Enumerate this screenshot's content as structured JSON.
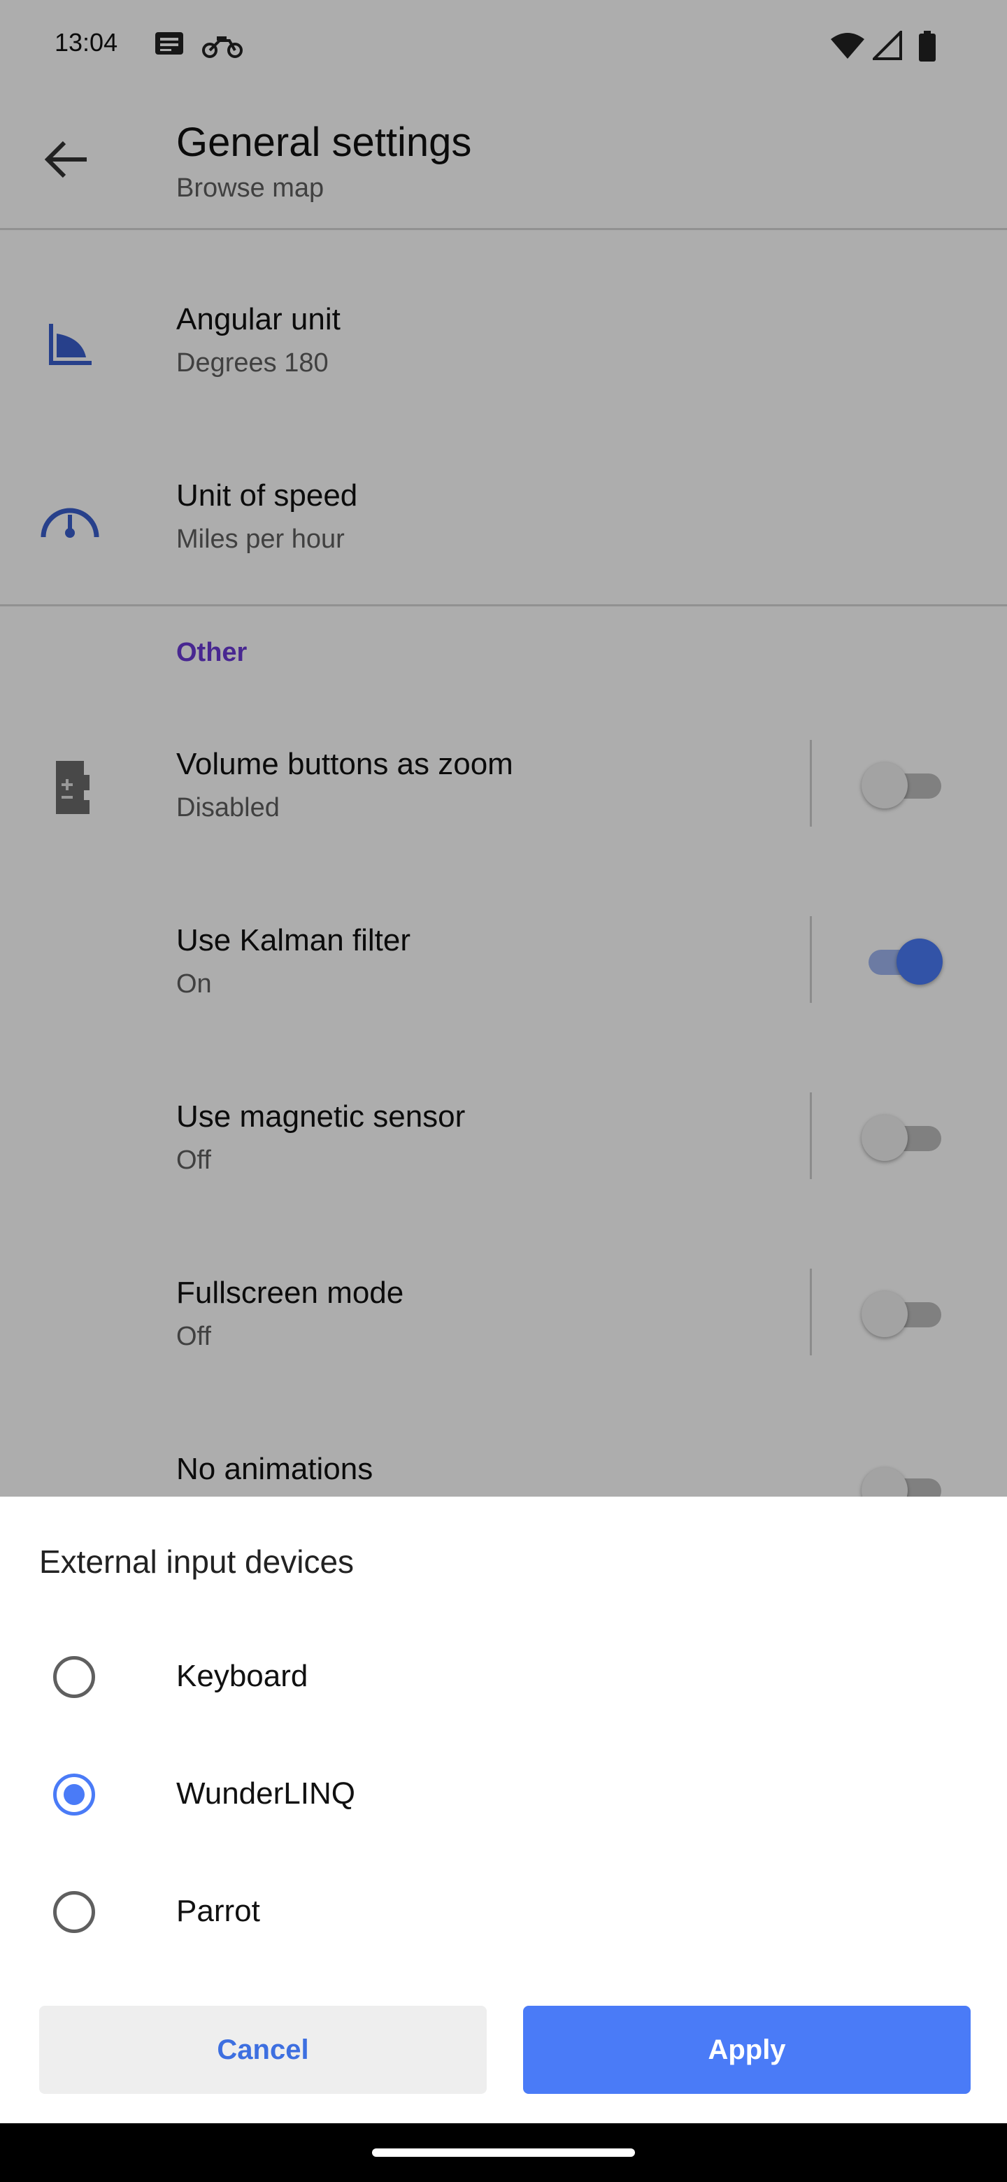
{
  "status_bar": {
    "time": "13:04",
    "notification_icons": [
      "message-icon",
      "motorcycle-icon"
    ],
    "system_icons": [
      "wifi-icon",
      "cellular-icon",
      "battery-icon"
    ]
  },
  "app_bar": {
    "title": "General settings",
    "subtitle": "Browse map",
    "back_icon": "arrow-back-icon"
  },
  "settings": {
    "angular_unit": {
      "title": "Angular unit",
      "summary": "Degrees 180",
      "icon": "angle-icon"
    },
    "speed_unit": {
      "title": "Unit of speed",
      "summary": "Miles per hour",
      "icon": "speedometer-icon"
    },
    "section_other": "Other",
    "volume_zoom": {
      "title": "Volume buttons as zoom",
      "summary": "Disabled",
      "icon": "volume-zoom-icon",
      "enabled": false
    },
    "kalman": {
      "title": "Use Kalman filter",
      "summary": "On",
      "enabled": true
    },
    "magnetic": {
      "title": "Use magnetic sensor",
      "summary": "Off",
      "enabled": false
    },
    "fullscreen": {
      "title": "Fullscreen mode",
      "summary": "Off",
      "enabled": false
    },
    "no_animations": {
      "title": "No animations",
      "enabled": false
    }
  },
  "dialog": {
    "title": "External input devices",
    "options": [
      {
        "label": "Keyboard",
        "selected": false
      },
      {
        "label": "WunderLINQ",
        "selected": true
      },
      {
        "label": "Parrot",
        "selected": false
      }
    ],
    "cancel_label": "Cancel",
    "apply_label": "Apply"
  },
  "colors": {
    "accent": "#4a7bf7",
    "section_header": "#6a3ad6",
    "icon_blue": "#3a5fcd"
  }
}
